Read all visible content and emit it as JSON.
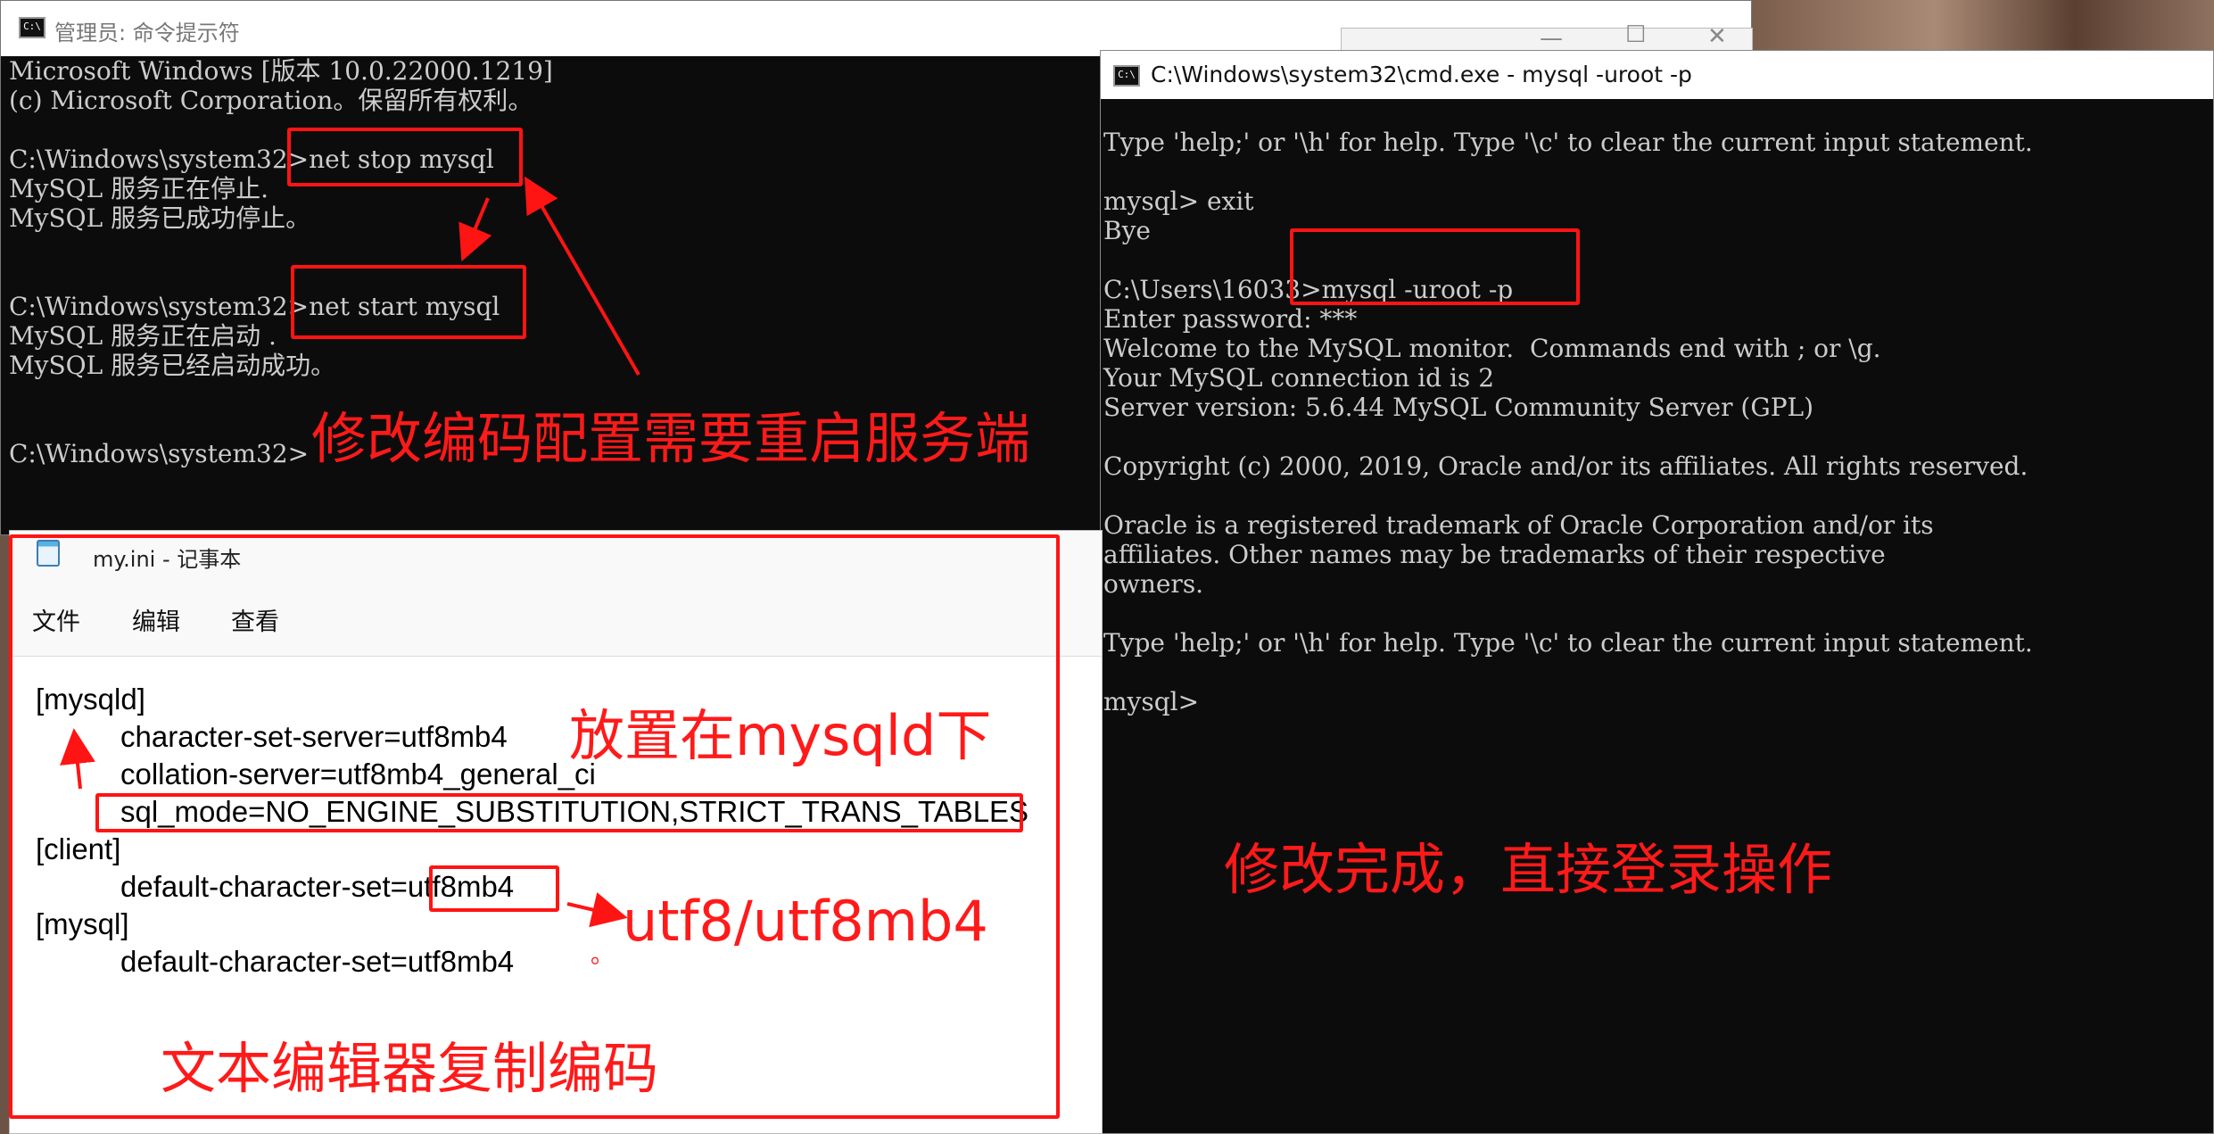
{
  "admin_window": {
    "title": "管理员: 命令提示符",
    "icon_label": "C:\\",
    "controls": {
      "minimize": "—",
      "maximize": "☐",
      "close": "✕"
    },
    "lines": [
      "Microsoft Windows [版本 10.0.22000.1219]",
      "(c) Microsoft Corporation。保留所有权利。",
      "",
      "C:\\Windows\\system32>net stop mysql",
      "MySQL 服务正在停止.",
      "MySQL 服务已成功停止。",
      "",
      "",
      "C:\\Windows\\system32>net start mysql",
      "MySQL 服务正在启动 .",
      "MySQL 服务已经启动成功。",
      "",
      "",
      "C:\\Windows\\system32>"
    ]
  },
  "mysql_window": {
    "title": "C:\\Windows\\system32\\cmd.exe - mysql  -uroot -p",
    "icon_label": "C:\\",
    "lines": [
      "Type 'help;' or '\\h' for help. Type '\\c' to clear the current input statement.",
      "",
      "mysql> exit",
      "Bye",
      "",
      "C:\\Users\\16033>mysql -uroot -p",
      "Enter password: ***",
      "Welcome to the MySQL monitor.  Commands end with ; or \\g.",
      "Your MySQL connection id is 2",
      "Server version: 5.6.44 MySQL Community Server (GPL)",
      "",
      "Copyright (c) 2000, 2019, Oracle and/or its affiliates. All rights reserved.",
      "",
      "Oracle is a registered trademark of Oracle Corporation and/or its",
      "affiliates. Other names may be trademarks of their respective",
      "owners.",
      "",
      "Type 'help;' or '\\h' for help. Type '\\c' to clear the current input statement.",
      "",
      "mysql>"
    ]
  },
  "notepad": {
    "title": "my.ini - 记事本",
    "menu": {
      "file": "文件",
      "edit": "编辑",
      "view": "查看"
    },
    "lines": {
      "l1": "[mysqld]",
      "l2": "character-set-server=utf8mb4",
      "l3": "collation-server=utf8mb4_general_ci",
      "l4": "sql_mode=NO_ENGINE_SUBSTITUTION,STRICT_TRANS_TABLES",
      "l5": "[client]",
      "l6": "default-character-set=utf8mb4",
      "l7": "[mysql]",
      "l8": "default-character-set=utf8mb4"
    },
    "stray_mark": "。"
  },
  "annotations": {
    "restart_note": "修改编码配置需要重启服务端",
    "placement_note": "放置在mysqld下",
    "charset_note": "utf8/utf8mb4",
    "copy_note": "文本编辑器复制编码",
    "login_note": "修改完成，直接登录操作",
    "color": "#ff1414"
  }
}
